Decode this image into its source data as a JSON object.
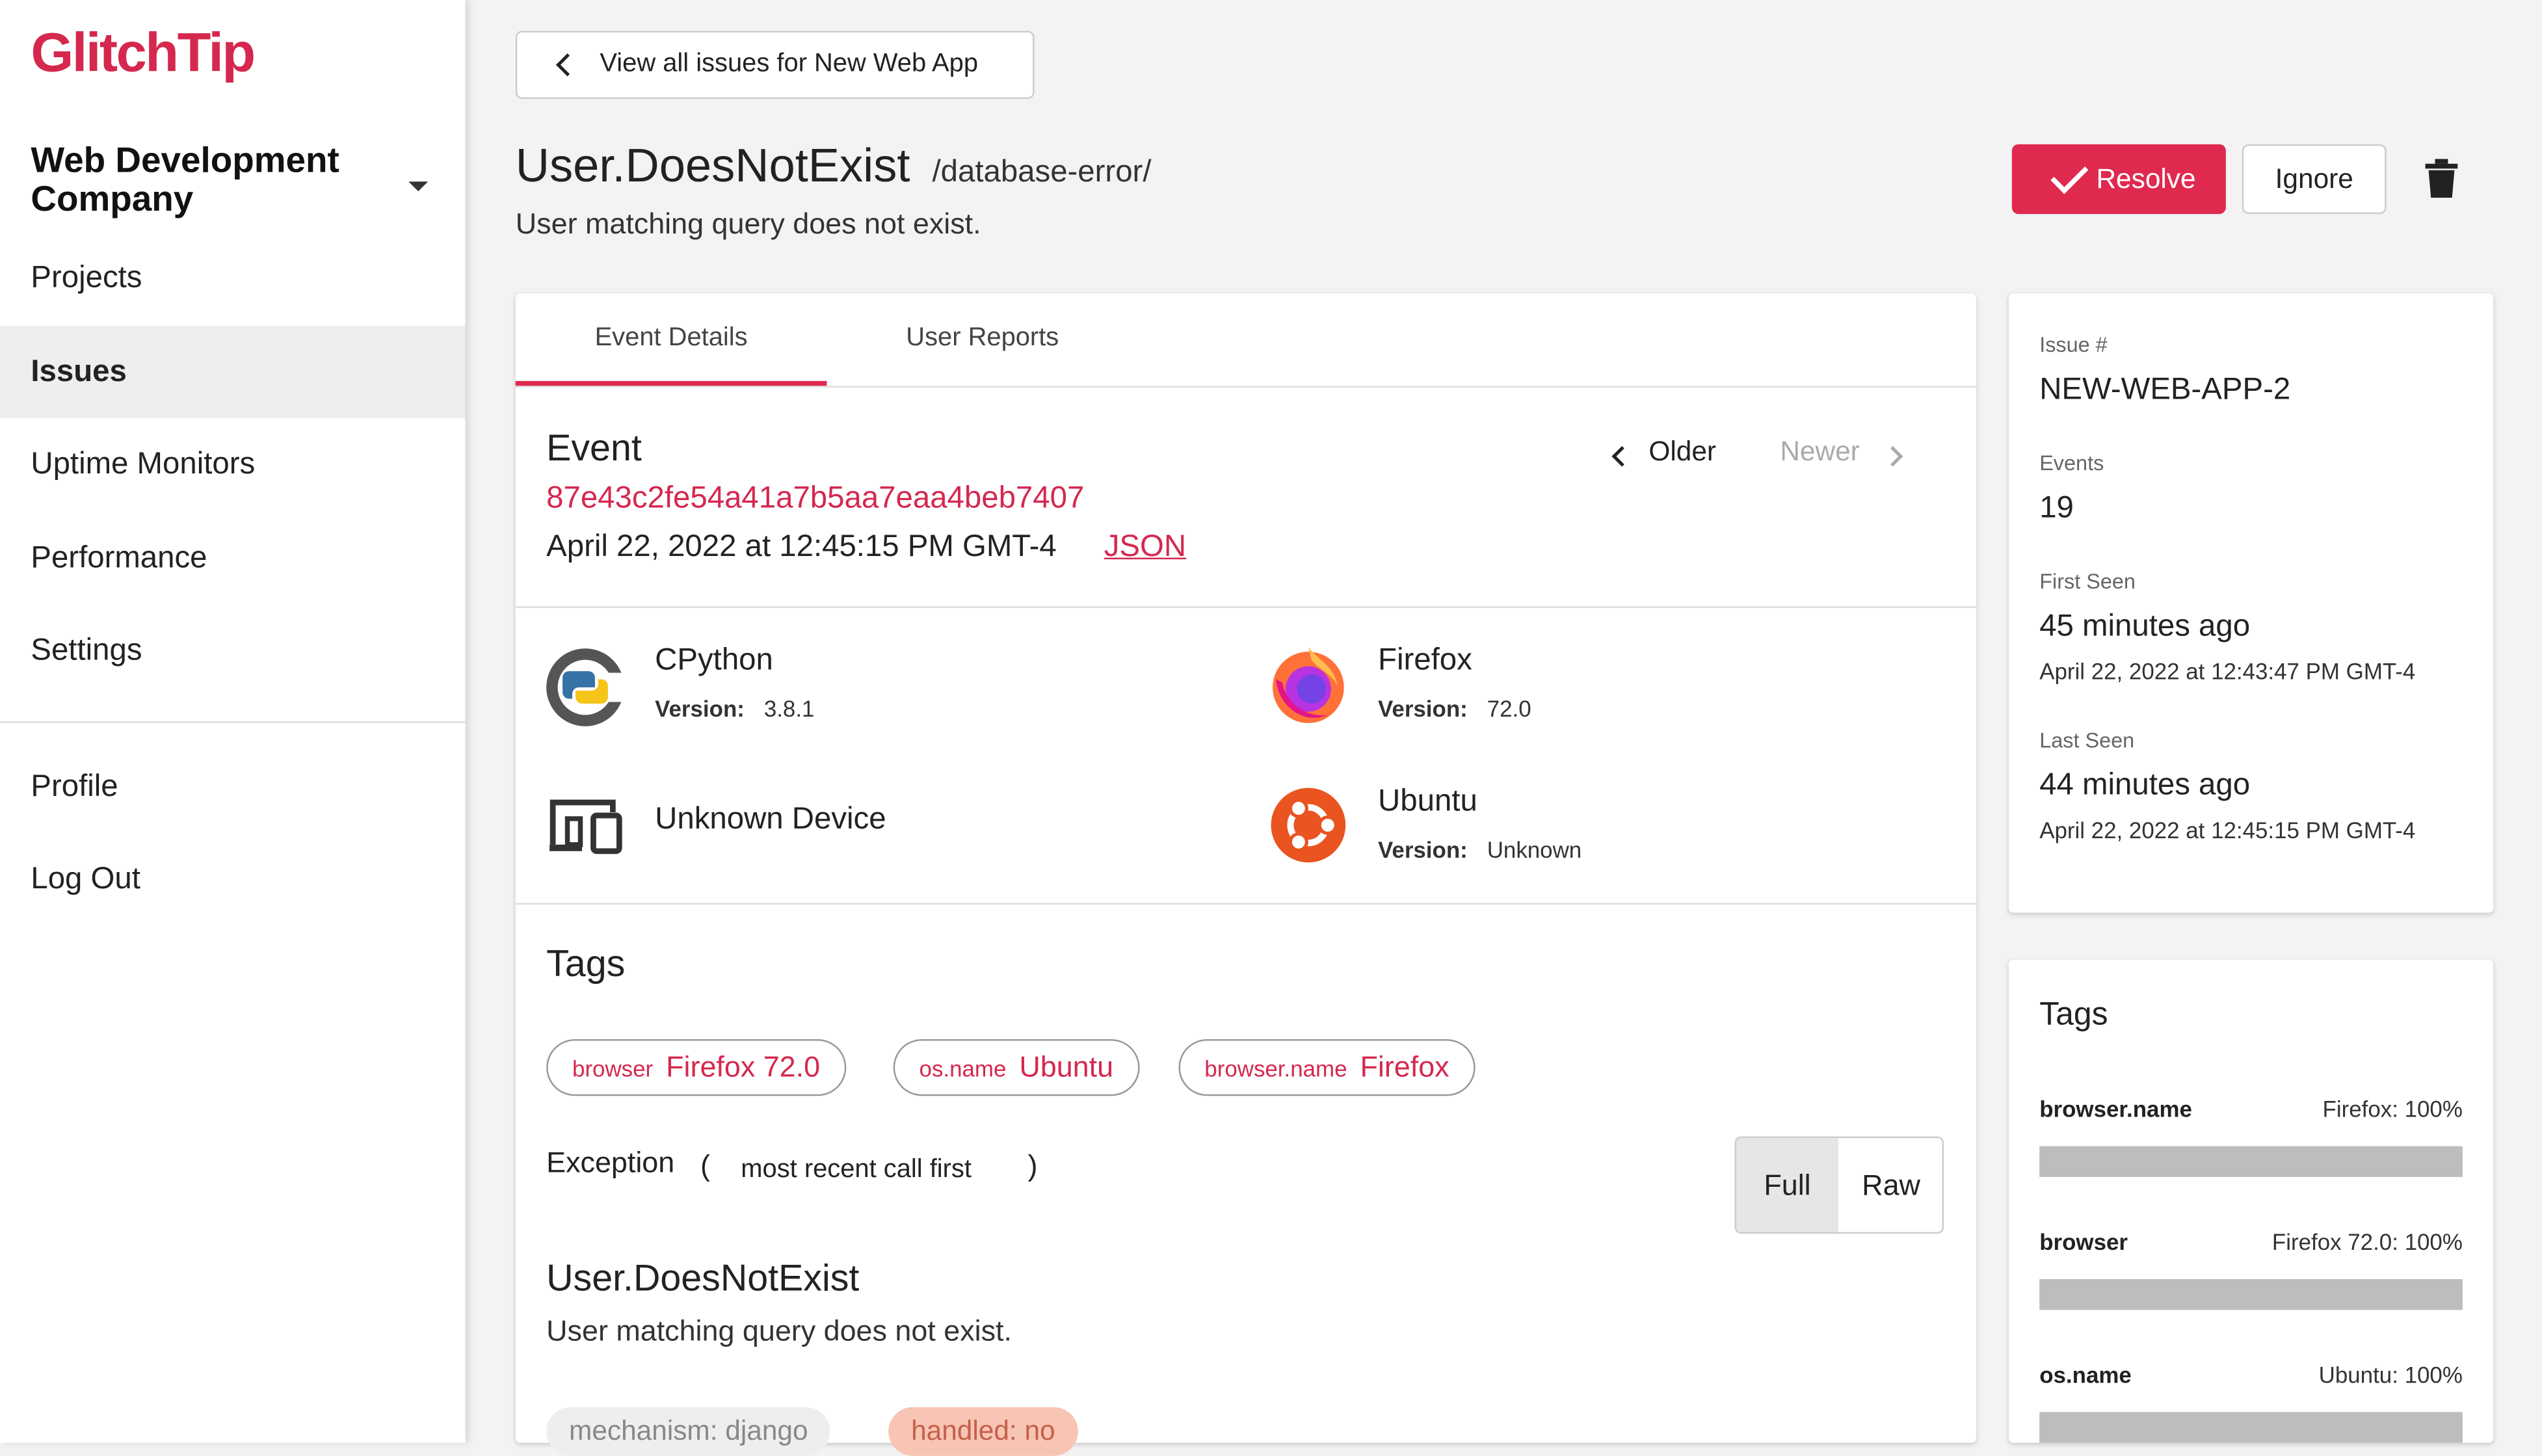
{
  "sidebar": {
    "logo": "GlitchTip",
    "org_name": "Web Development Company",
    "nav": [
      "Projects",
      "Issues",
      "Uptime Monitors",
      "Performance",
      "Settings"
    ],
    "active_nav": "Issues",
    "account": [
      "Profile",
      "Log Out"
    ]
  },
  "header": {
    "back_label": "View all issues for New Web App",
    "title": "User.DoesNotExist",
    "culprit": "/database-error/",
    "subtitle": "User matching query does not exist.",
    "resolve_label": "Resolve",
    "ignore_label": "Ignore",
    "delete_icon": "trash-icon"
  },
  "event_card": {
    "tabs": [
      "Event Details",
      "User Reports"
    ],
    "active_tab": "Event Details",
    "heading": "Event",
    "event_id": "87e43c2fe54a41a7b5aa7eaa4beb7407",
    "date": "April 22, 2022 at 12:45:15 PM GMT-4",
    "json_label": "JSON",
    "older_label": "Older",
    "newer_label": "Newer",
    "contexts": [
      {
        "icon": "python-icon",
        "name": "CPython",
        "version_label": "Version:",
        "version": "3.8.1"
      },
      {
        "icon": "firefox-icon",
        "name": "Firefox",
        "version_label": "Version:",
        "version": "72.0"
      },
      {
        "icon": "device-icon",
        "name": "Unknown Device"
      },
      {
        "icon": "ubuntu-icon",
        "name": "Ubuntu",
        "version_label": "Version:",
        "version": "Unknown"
      }
    ],
    "tags_heading": "Tags",
    "tags": [
      {
        "key": "browser",
        "value": "Firefox 72.0"
      },
      {
        "key": "os.name",
        "value": "Ubuntu"
      },
      {
        "key": "browser.name",
        "value": "Firefox"
      }
    ],
    "exception_label": "Exception",
    "open_paren": "(",
    "order_label": "most recent call first",
    "close_paren": ")",
    "view_toggle": [
      "Full",
      "Raw"
    ],
    "active_view": "Full",
    "exception_type": "User.DoesNotExist",
    "exception_message": "User matching query does not exist.",
    "pills": [
      {
        "text": "mechanism: django",
        "bg": "#eeeeee",
        "color": "#888888"
      },
      {
        "text": "handled: no",
        "bg": "#f8c4b4",
        "color": "#c5604a"
      }
    ]
  },
  "meta": {
    "issue_label": "Issue #",
    "issue_value": "NEW-WEB-APP-2",
    "events_label": "Events",
    "events_value": "19",
    "first_seen_label": "First Seen",
    "first_seen_value": "45 minutes ago",
    "first_seen_date": "April 22, 2022 at 12:43:47 PM GMT-4",
    "last_seen_label": "Last Seen",
    "last_seen_value": "44 minutes ago",
    "last_seen_date": "April 22, 2022 at 12:45:15 PM GMT-4"
  },
  "tag_summary": {
    "heading": "Tags",
    "items": [
      {
        "key": "browser.name",
        "summary": "Firefox: 100%",
        "fraction": 1.0
      },
      {
        "key": "browser",
        "summary": "Firefox 72.0: 100%",
        "fraction": 1.0
      },
      {
        "key": "os.name",
        "summary": "Ubuntu: 100%",
        "fraction": 1.0
      }
    ]
  },
  "colors": {
    "accent": "#e0294f",
    "link": "#d5284f"
  }
}
